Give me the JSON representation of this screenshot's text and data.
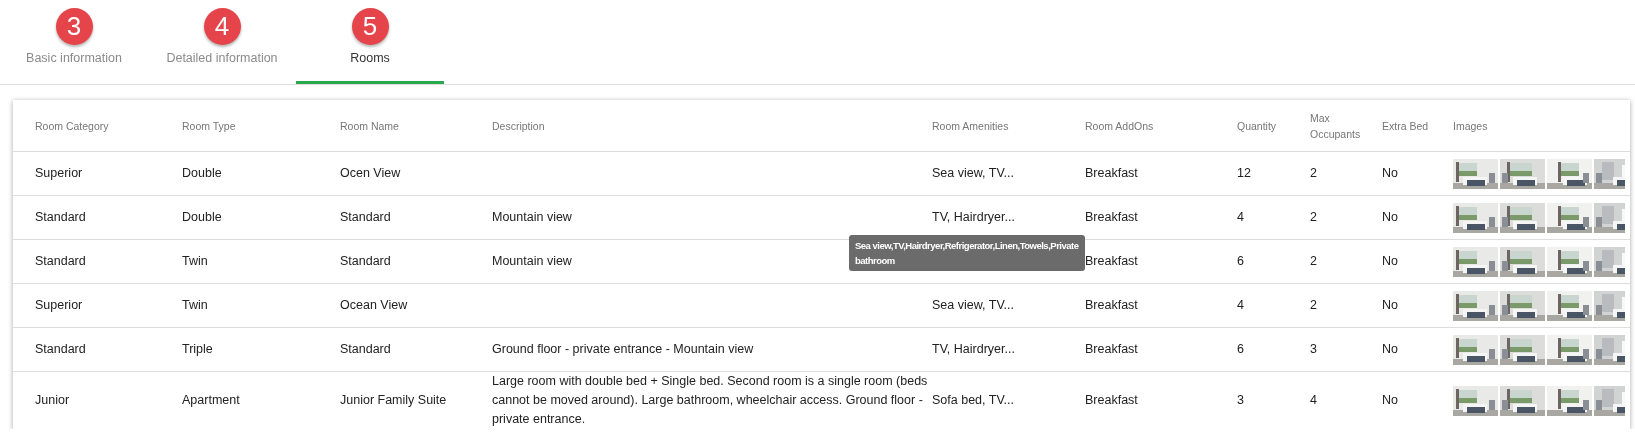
{
  "tabs": [
    {
      "number": "3",
      "label": "Basic information",
      "selected": false
    },
    {
      "number": "4",
      "label": "Detailed information",
      "selected": false
    },
    {
      "number": "5",
      "label": "Rooms",
      "selected": true
    }
  ],
  "table": {
    "columns": [
      "Room Category",
      "Room Type",
      "Room Name",
      "Description",
      "Room Amenities",
      "Room AddOns",
      "Quantity",
      "Max Occupants",
      "Extra Bed",
      "Images"
    ],
    "rows": [
      {
        "category": "Superior",
        "type": "Double",
        "name": "Ocen View",
        "amenities": "Sea view, TV...",
        "addons": "Breakfast",
        "quantity": "12",
        "max_occupants": "2",
        "extra_bed": "No"
      },
      {
        "category": "Standard",
        "type": "Double",
        "name": "Standard",
        "description": "Mountain view",
        "amenities": "TV, Hairdryer...",
        "addons": "Breakfast",
        "quantity": "4",
        "max_occupants": "2",
        "extra_bed": "No"
      },
      {
        "category": "Standard",
        "type": "Twin",
        "name": "Standard",
        "description": "Mountain view",
        "tooltip": "Sea view,TV,Hairdryer,Refrigerator,Linen,Towels,Private bathroom",
        "addons": "Breakfast",
        "quantity": "6",
        "max_occupants": "2",
        "extra_bed": "No"
      },
      {
        "category": "Superior",
        "type": "Twin",
        "name": "Ocean View",
        "amenities": "Sea view, TV...",
        "addons": "Breakfast",
        "quantity": "4",
        "max_occupants": "2",
        "extra_bed": "No"
      },
      {
        "category": "Standard",
        "type": "Triple",
        "name": "Standard",
        "description": "Ground floor - private entrance - Mountain view",
        "amenities": "TV, Hairdryer...",
        "addons": "Breakfast",
        "quantity": "6",
        "max_occupants": "3",
        "extra_bed": "No"
      },
      {
        "category": "Junior",
        "type": "Apartment",
        "name": "Junior Family Suite",
        "description": "Large room with double bed + Single bed. Second room is a single room (beds cannot be moved around). Large bathroom, wheelchair access. Ground floor - private entrance.",
        "amenities": "Sofa bed, TV...",
        "addons": "Breakfast",
        "quantity": "3",
        "max_occupants": "4",
        "extra_bed": "No"
      }
    ]
  }
}
